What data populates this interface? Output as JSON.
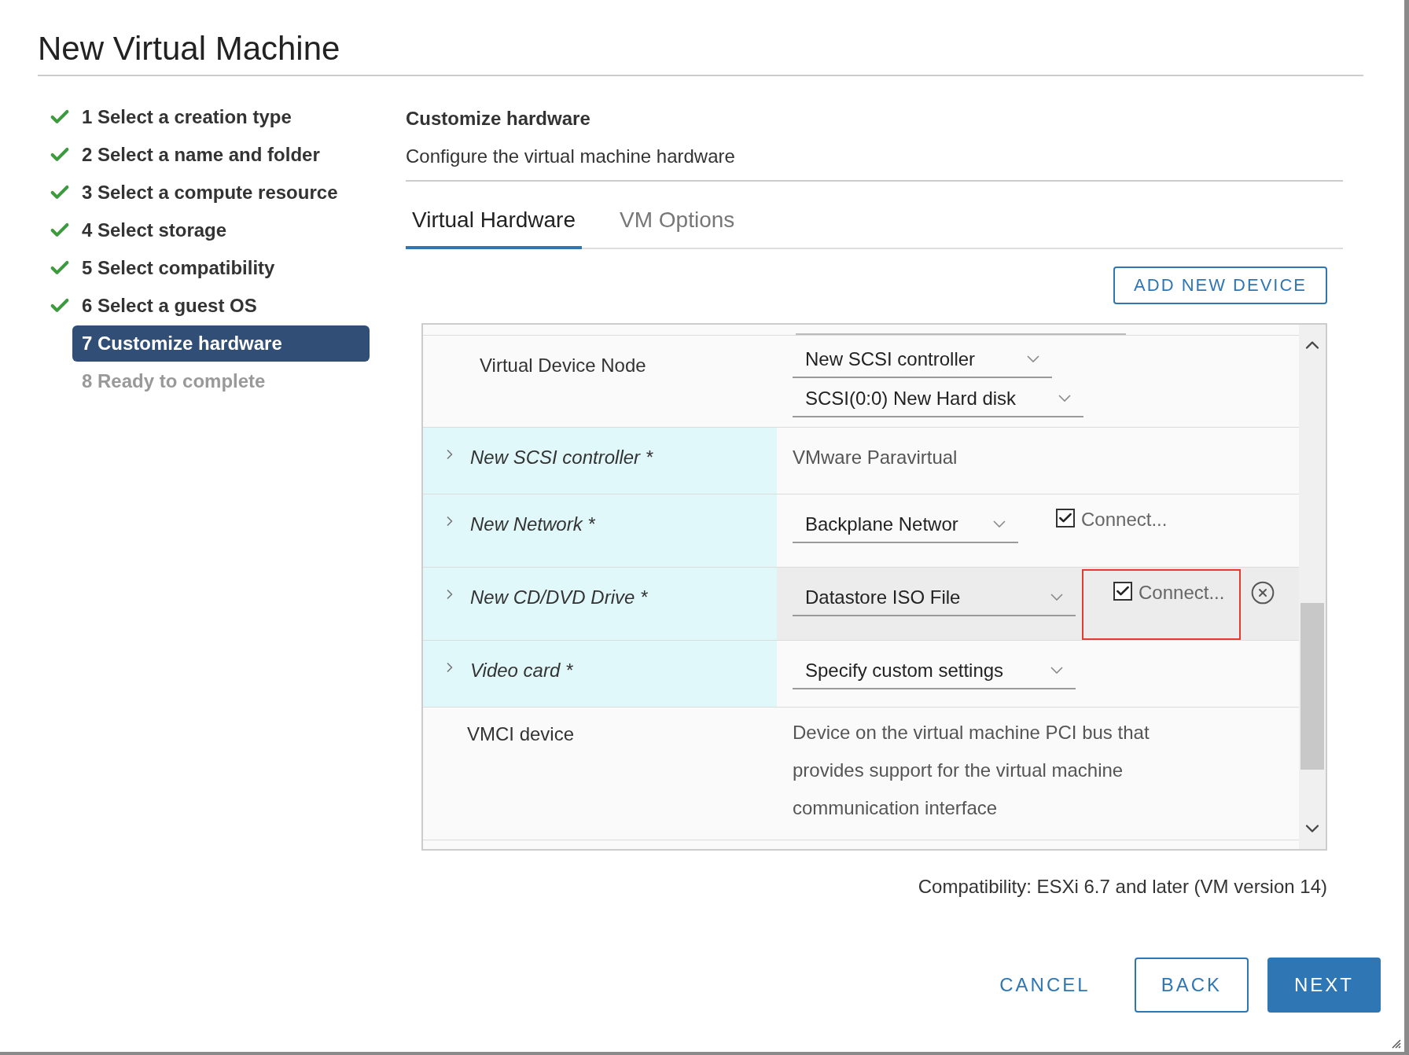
{
  "window": {
    "title": "New Virtual Machine"
  },
  "steps": [
    {
      "label": "1 Select a creation type",
      "completed": true,
      "selected": false,
      "disabled": false
    },
    {
      "label": "2 Select a name and folder",
      "completed": true,
      "selected": false,
      "disabled": false
    },
    {
      "label": "3 Select a compute resource",
      "completed": true,
      "selected": false,
      "disabled": false
    },
    {
      "label": "4 Select storage",
      "completed": true,
      "selected": false,
      "disabled": false
    },
    {
      "label": "5 Select compatibility",
      "completed": true,
      "selected": false,
      "disabled": false
    },
    {
      "label": "6 Select a guest OS",
      "completed": true,
      "selected": false,
      "disabled": false
    },
    {
      "label": "7 Customize hardware",
      "completed": false,
      "selected": true,
      "disabled": false
    },
    {
      "label": "8 Ready to complete",
      "completed": false,
      "selected": false,
      "disabled": true
    }
  ],
  "header": {
    "title": "Customize hardware",
    "subtitle": "Configure the virtual machine hardware"
  },
  "tabs": [
    {
      "label": "Virtual Hardware",
      "selected": true
    },
    {
      "label": "VM Options",
      "selected": false
    }
  ],
  "add_button": "ADD NEW DEVICE",
  "hardware_rows": [
    {
      "kind": "node",
      "label": "Virtual Device Node",
      "selects": [
        "New SCSI controller",
        "SCSI(0:0) New Hard disk"
      ]
    },
    {
      "kind": "device",
      "label": "New SCSI controller *",
      "value": "VMware Paravirtual",
      "hovered": false
    },
    {
      "kind": "device",
      "label": "New Network *",
      "select": "Backplane Networ",
      "connect": {
        "label": "Connect...",
        "checked": true
      },
      "hovered": false
    },
    {
      "kind": "device",
      "label": "New CD/DVD Drive *",
      "select": "Datastore ISO File",
      "connect": {
        "label": "Connect...",
        "checked": true,
        "highlighted": true
      },
      "removable": true,
      "hovered": true
    },
    {
      "kind": "device",
      "label": "Video card *",
      "select": "Specify custom settings",
      "hovered": false
    },
    {
      "kind": "info",
      "label": "VMCI device",
      "description": "Device on the virtual machine PCI bus that provides support for the virtual machine communication interface"
    }
  ],
  "compatibility": "Compatibility: ESXi 6.7 and later (VM version 14)",
  "buttons": [
    {
      "label": "CANCEL",
      "kind": "flat"
    },
    {
      "label": "BACK",
      "kind": "outline"
    },
    {
      "label": "NEXT",
      "kind": "primary"
    }
  ]
}
